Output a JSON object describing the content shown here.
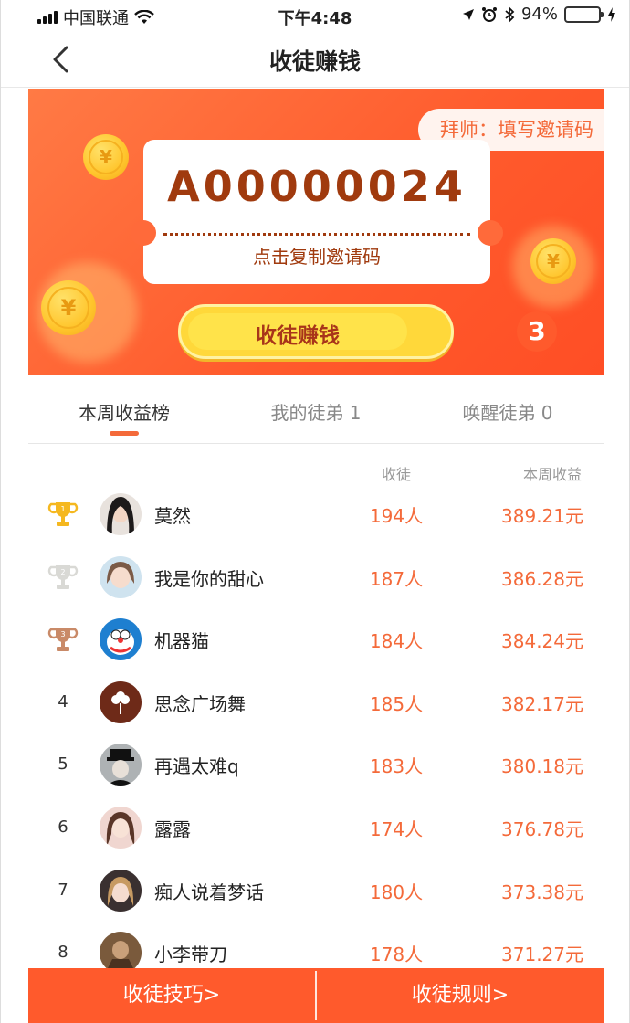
{
  "status": {
    "carrier": "中国联通",
    "time": "下午4:48",
    "battery": "94%",
    "battery_level": 0.94,
    "battery_color": "#4cd964"
  },
  "nav": {
    "title": "收徒赚钱",
    "back_icon": "chevron-left-icon"
  },
  "banner": {
    "badge": "拜师：填写邀请码",
    "invite_code": "A00000024",
    "copy_label": "点击复制邀请码",
    "button_label": "收徒赚钱",
    "button_count": "3",
    "coin_symbol": "¥",
    "accent": "#ff5a2c"
  },
  "tabs": [
    {
      "label": "本周收益榜"
    },
    {
      "label": "我的徒弟 1"
    },
    {
      "label": "唤醒徒弟 0"
    }
  ],
  "list": {
    "col_count": "收徒",
    "col_income": "本周收益",
    "rows": [
      {
        "rank": "1",
        "medal": "gold-trophy-icon",
        "name": "莫然",
        "count": "194人",
        "income": "389.21元"
      },
      {
        "rank": "2",
        "medal": "silver-trophy-icon",
        "name": "我是你的甜心",
        "count": "187人",
        "income": "386.28元"
      },
      {
        "rank": "3",
        "medal": "bronze-trophy-icon",
        "name": "机器猫",
        "count": "184人",
        "income": "384.24元"
      },
      {
        "rank": "4",
        "name": "思念广场舞",
        "count": "185人",
        "income": "382.17元"
      },
      {
        "rank": "5",
        "name": "再遇太难q",
        "count": "183人",
        "income": "380.18元"
      },
      {
        "rank": "6",
        "name": "露露",
        "count": "174人",
        "income": "376.78元"
      },
      {
        "rank": "7",
        "name": "痴人说着梦话",
        "count": "180人",
        "income": "373.38元"
      },
      {
        "rank": "8",
        "name": "小李带刀",
        "count": "178人",
        "income": "371.27元"
      }
    ]
  },
  "footer": {
    "tips": "收徒技巧>",
    "rules": "收徒规则>"
  }
}
